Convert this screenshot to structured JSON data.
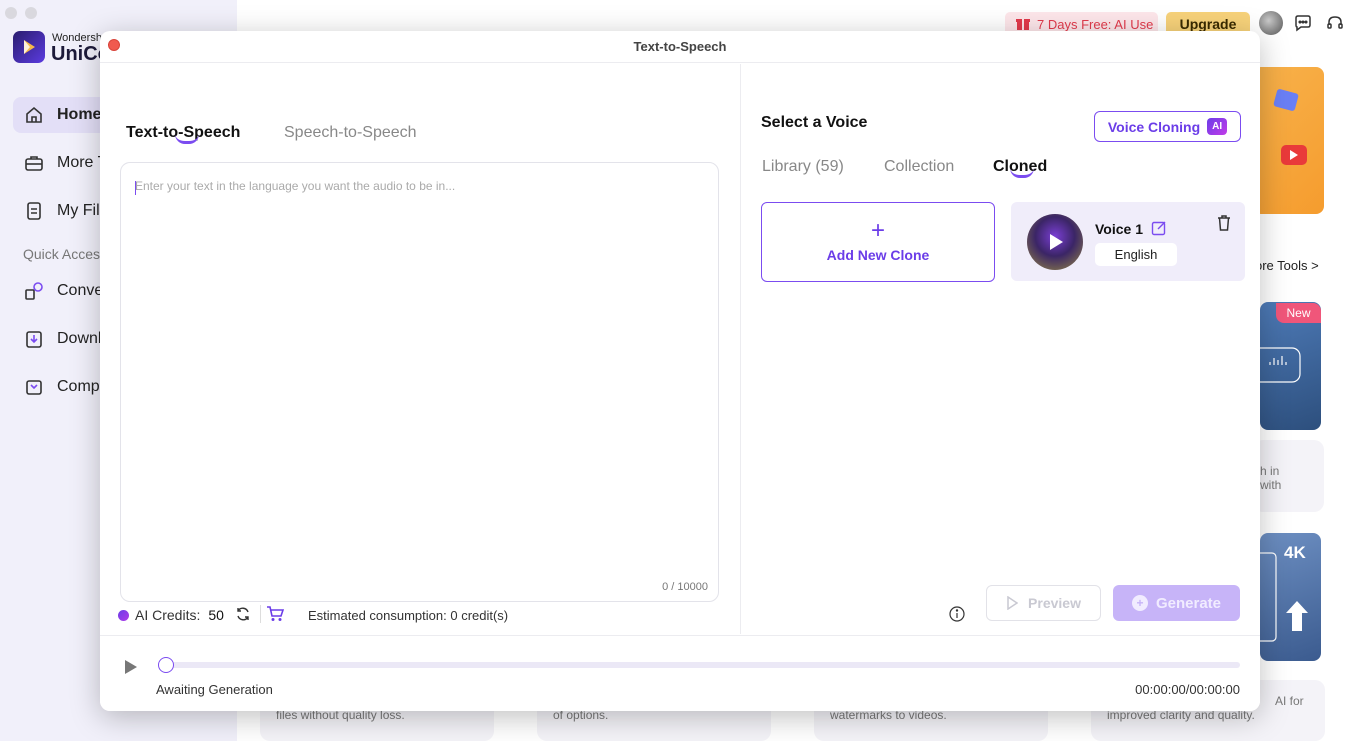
{
  "app": {
    "brand_top": "Wondersh",
    "brand_name": "UniCo",
    "nav": [
      {
        "label": "Home",
        "icon": "home-icon"
      },
      {
        "label": "More T",
        "icon": "toolbox-icon"
      },
      {
        "label": "My Fil",
        "icon": "file-icon"
      }
    ],
    "quick_access_label": "Quick Acces",
    "quick": [
      {
        "label": "Conve",
        "icon": "convert-icon"
      },
      {
        "label": "Downl",
        "icon": "download-icon"
      },
      {
        "label": "Comp",
        "icon": "compress-icon"
      }
    ],
    "promo": "7 Days Free: AI Use",
    "upgrade": "Upgrade",
    "more_tools": "ore Tools >",
    "new_badge": "New",
    "fourk_badge": "4K",
    "card_texts": {
      "right_mid_1": "h in",
      "right_mid_2": "with",
      "bottom_1": "files without quality loss.",
      "bottom_2": "of options.",
      "bottom_3": "watermarks to videos.",
      "bottom_4a": "AI for",
      "bottom_4b": "improved clarity and quality."
    }
  },
  "modal": {
    "title": "Text-to-Speech",
    "tabs": [
      {
        "label": "Text-to-Speech",
        "active": true
      },
      {
        "label": "Speech-to-Speech",
        "active": false
      }
    ],
    "input": {
      "placeholder": "Enter your text in the language you want the audio to be in...",
      "value": "",
      "char_count": "0 / 10000"
    },
    "voice_panel": {
      "title": "Select a Voice",
      "clone_button": "Voice Cloning",
      "ai_badge": "AI",
      "tabs": [
        {
          "label": "Library (59)",
          "active": false
        },
        {
          "label": "Collection",
          "active": false
        },
        {
          "label": "Cloned",
          "active": true
        }
      ],
      "add_clone_label": "Add New Clone",
      "voices": [
        {
          "name": "Voice 1",
          "language": "English"
        }
      ]
    },
    "footer": {
      "credits_label": "AI Credits:",
      "credits_value": "50",
      "estimate": "Estimated consumption: 0 credit(s)",
      "preview": "Preview",
      "generate": "Generate"
    },
    "player": {
      "status": "Awaiting Generation",
      "time": "00:00:00/00:00:00",
      "progress": 0
    }
  },
  "colors": {
    "accent": "#7b4cf0",
    "promo_text": "#e23a4c",
    "upgrade_bg": "#f7d27a",
    "generate_disabled": "#c7b4f8"
  }
}
